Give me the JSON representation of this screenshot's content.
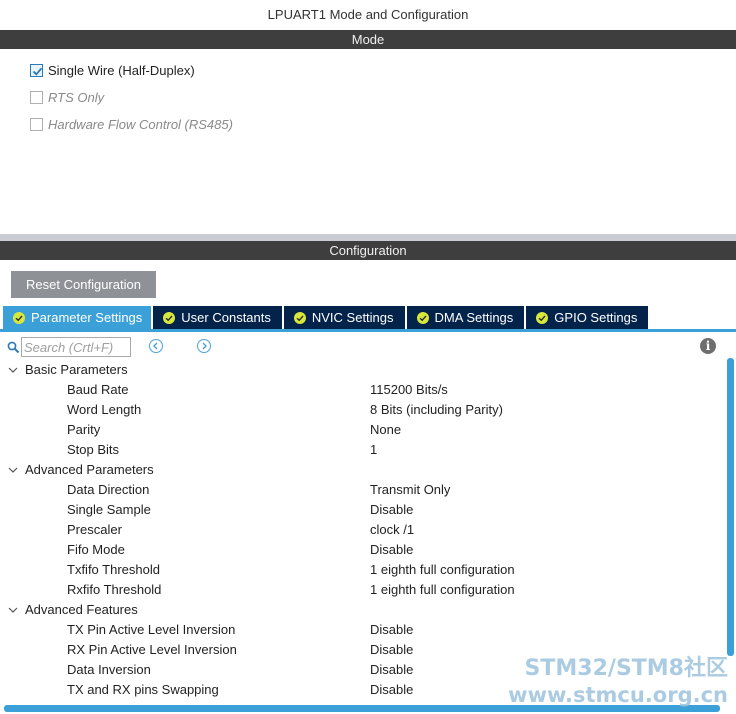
{
  "window": {
    "title": "LPUART1 Mode and Configuration"
  },
  "mode": {
    "header": "Mode",
    "options": [
      {
        "label": "Single Wire (Half-Duplex)",
        "checked": true,
        "enabled": true
      },
      {
        "label": "RTS Only",
        "checked": false,
        "enabled": false
      },
      {
        "label": "Hardware Flow Control (RS485)",
        "checked": false,
        "enabled": false
      }
    ]
  },
  "configuration": {
    "header": "Configuration",
    "reset_button": "Reset Configuration",
    "tabs": [
      {
        "label": "Parameter Settings",
        "active": true
      },
      {
        "label": "User Constants",
        "active": false
      },
      {
        "label": "NVIC Settings",
        "active": false
      },
      {
        "label": "DMA Settings",
        "active": false
      },
      {
        "label": "GPIO Settings",
        "active": false
      }
    ],
    "search": {
      "placeholder": "Search (Crtl+F)"
    },
    "groups": [
      {
        "name": "Basic Parameters",
        "params": [
          {
            "name": "Baud Rate",
            "value": "115200 Bits/s"
          },
          {
            "name": "Word Length",
            "value": "8 Bits (including Parity)"
          },
          {
            "name": "Parity",
            "value": "None"
          },
          {
            "name": "Stop Bits",
            "value": "1"
          }
        ]
      },
      {
        "name": "Advanced Parameters",
        "params": [
          {
            "name": "Data Direction",
            "value": "Transmit Only"
          },
          {
            "name": "Single Sample",
            "value": "Disable"
          },
          {
            "name": "Prescaler",
            "value": "clock /1"
          },
          {
            "name": "Fifo Mode",
            "value": "Disable"
          },
          {
            "name": "Txfifo Threshold",
            "value": "1 eighth full configuration"
          },
          {
            "name": "Rxfifo Threshold",
            "value": "1 eighth full configuration"
          }
        ]
      },
      {
        "name": "Advanced Features",
        "params": [
          {
            "name": "TX Pin Active Level Inversion",
            "value": "Disable"
          },
          {
            "name": "RX Pin Active Level Inversion",
            "value": "Disable"
          },
          {
            "name": "Data Inversion",
            "value": "Disable"
          },
          {
            "name": "TX and RX pins Swapping",
            "value": "Disable"
          }
        ]
      }
    ]
  },
  "watermark": {
    "line1": "STM32/STM8社区",
    "line2": "www.stmcu.org.cn"
  },
  "colors": {
    "tab_active": "#3ca0d8",
    "tab_inactive": "#03234b",
    "header_bar": "#3e3e3e",
    "check_ok": "#d8e83a"
  },
  "icons": {
    "search": "search-icon",
    "prev": "chevron-left-icon",
    "next": "chevron-right-icon",
    "info": "info-icon",
    "tab_status": "check-circle-icon"
  }
}
